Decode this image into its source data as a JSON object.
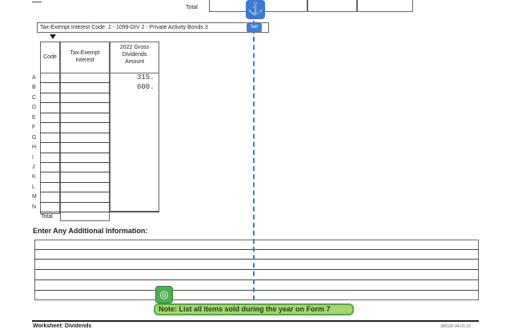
{
  "top_total_label": "Total",
  "code_line": "Tax-Exempt Interest Code: 1 - 1099-DIV  2 - Private Activity Bonds  3",
  "code_select_value": "Sel",
  "table": {
    "headers": {
      "code": "Code",
      "tax_exempt": "Tax-Exempt Interest",
      "gross_div": "2022 Gross Dividends Amount"
    },
    "row_labels": [
      "A",
      "B",
      "C",
      "D",
      "E",
      "F",
      "G",
      "H",
      "I",
      "J",
      "K",
      "L",
      "M",
      "N"
    ],
    "gross_dividends_values": [
      "315.",
      "600."
    ],
    "total_label": "Total"
  },
  "additional_info_heading": "Enter Any Additional Information:",
  "note_text": "Note: List all items sold during the year on Form 7",
  "footer": {
    "left": "Worksheet: Dividends",
    "right": "380182  04-01-23"
  },
  "icons": {
    "anchor": "anchor-icon",
    "target": "target-icon",
    "marker": "down-triangle-icon"
  }
}
